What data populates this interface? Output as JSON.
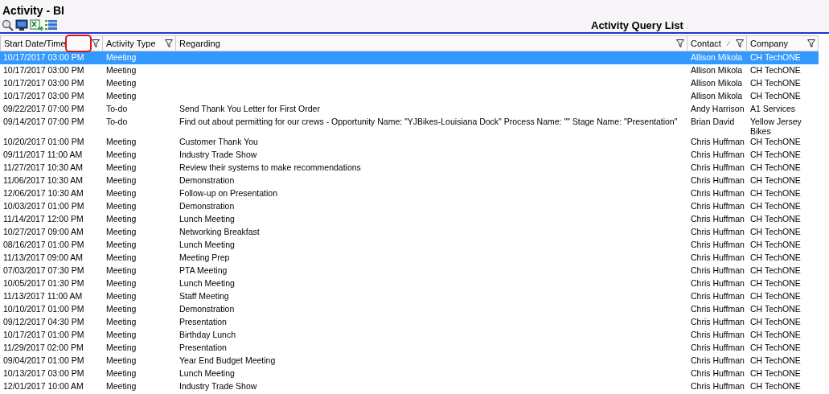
{
  "window": {
    "title": "Activity - BI"
  },
  "list_title": "Activity Query List",
  "table": {
    "columns": [
      {
        "label": "Start Date/Time",
        "filter": true
      },
      {
        "label": "Activity Type",
        "filter": true
      },
      {
        "label": "Regarding",
        "filter": true
      },
      {
        "label": "Contact",
        "filter": true,
        "sorted": true
      },
      {
        "label": "Company",
        "filter": true
      }
    ],
    "rows": [
      {
        "selected": true,
        "cells": [
          "10/17/2017 03:00 PM",
          "Meeting",
          "",
          "Allison Mikola",
          "CH TechONE"
        ]
      },
      {
        "selected": false,
        "cells": [
          "10/17/2017 03:00 PM",
          "Meeting",
          "",
          "Allison Mikola",
          "CH TechONE"
        ]
      },
      {
        "selected": false,
        "cells": [
          "10/17/2017 03:00 PM",
          "Meeting",
          "",
          "Allison Mikola",
          "CH TechONE"
        ]
      },
      {
        "selected": false,
        "cells": [
          "10/17/2017 03:00 PM",
          "Meeting",
          "",
          "Allison Mikola",
          "CH TechONE"
        ]
      },
      {
        "selected": false,
        "cells": [
          "09/22/2017 07:00 PM",
          "To-do",
          "Send Thank You Letter for First Order",
          "Andy Harrison",
          "A1 Services"
        ]
      },
      {
        "selected": false,
        "cells": [
          "09/14/2017 07:00 PM",
          "To-do",
          "Find out about permitting for our crews - Opportunity Name: \"YJBikes-Louisiana Dock\" Process Name: \"\" Stage Name: \"Presentation\"",
          "Brian David",
          "Yellow Jersey Bikes"
        ]
      },
      {
        "selected": false,
        "cells": [
          "10/20/2017 01:00 PM",
          "Meeting",
          "Customer Thank You",
          "Chris Huffman",
          "CH TechONE"
        ]
      },
      {
        "selected": false,
        "cells": [
          "09/11/2017 11:00 AM",
          "Meeting",
          "Industry Trade Show",
          "Chris Huffman",
          "CH TechONE"
        ]
      },
      {
        "selected": false,
        "cells": [
          "11/27/2017 10:30 AM",
          "Meeting",
          "Review their systems to make recommendations",
          "Chris Huffman",
          "CH TechONE"
        ]
      },
      {
        "selected": false,
        "cells": [
          "11/06/2017 10:30 AM",
          "Meeting",
          "Demonstration",
          "Chris Huffman",
          "CH TechONE"
        ]
      },
      {
        "selected": false,
        "cells": [
          "12/06/2017 10:30 AM",
          "Meeting",
          "Follow-up on Presentation",
          "Chris Huffman",
          "CH TechONE"
        ]
      },
      {
        "selected": false,
        "cells": [
          "10/03/2017 01:00 PM",
          "Meeting",
          "Demonstration",
          "Chris Huffman",
          "CH TechONE"
        ]
      },
      {
        "selected": false,
        "cells": [
          "11/14/2017 12:00 PM",
          "Meeting",
          "Lunch Meeting",
          "Chris Huffman",
          "CH TechONE"
        ]
      },
      {
        "selected": false,
        "cells": [
          "10/27/2017 09:00 AM",
          "Meeting",
          "Networking Breakfast",
          "Chris Huffman",
          "CH TechONE"
        ]
      },
      {
        "selected": false,
        "cells": [
          "08/16/2017 01:00 PM",
          "Meeting",
          "Lunch Meeting",
          "Chris Huffman",
          "CH TechONE"
        ]
      },
      {
        "selected": false,
        "cells": [
          "11/13/2017 09:00 AM",
          "Meeting",
          "Meeting Prep",
          "Chris Huffman",
          "CH TechONE"
        ]
      },
      {
        "selected": false,
        "cells": [
          "07/03/2017 07:30 PM",
          "Meeting",
          "PTA Meeting",
          "Chris Huffman",
          "CH TechONE"
        ]
      },
      {
        "selected": false,
        "cells": [
          "10/05/2017 01:30 PM",
          "Meeting",
          "Lunch Meeting",
          "Chris Huffman",
          "CH TechONE"
        ]
      },
      {
        "selected": false,
        "cells": [
          "11/13/2017 11:00 AM",
          "Meeting",
          "Staff Meeting",
          "Chris Huffman",
          "CH TechONE"
        ]
      },
      {
        "selected": false,
        "cells": [
          "10/10/2017 01:00 PM",
          "Meeting",
          "Demonstration",
          "Chris Huffman",
          "CH TechONE"
        ]
      },
      {
        "selected": false,
        "cells": [
          "09/12/2017 04:30 PM",
          "Meeting",
          "Presentation",
          "Chris Huffman",
          "CH TechONE"
        ]
      },
      {
        "selected": false,
        "cells": [
          "10/17/2017 01:00 PM",
          "Meeting",
          "Birthday Lunch",
          "Chris Huffman",
          "CH TechONE"
        ]
      },
      {
        "selected": false,
        "cells": [
          "11/29/2017 02:00 PM",
          "Meeting",
          "Presentation",
          "Chris Huffman",
          "CH TechONE"
        ]
      },
      {
        "selected": false,
        "cells": [
          "09/04/2017 01:00 PM",
          "Meeting",
          "Year End Budget Meeting",
          "Chris Huffman",
          "CH TechONE"
        ]
      },
      {
        "selected": false,
        "cells": [
          "10/13/2017 03:00 PM",
          "Meeting",
          "Lunch Meeting",
          "Chris Huffman",
          "CH TechONE"
        ]
      },
      {
        "selected": false,
        "cells": [
          "12/01/2017 10:00 AM",
          "Meeting",
          "Industry Trade Show",
          "Chris Huffman",
          "CH TechONE"
        ]
      }
    ]
  }
}
